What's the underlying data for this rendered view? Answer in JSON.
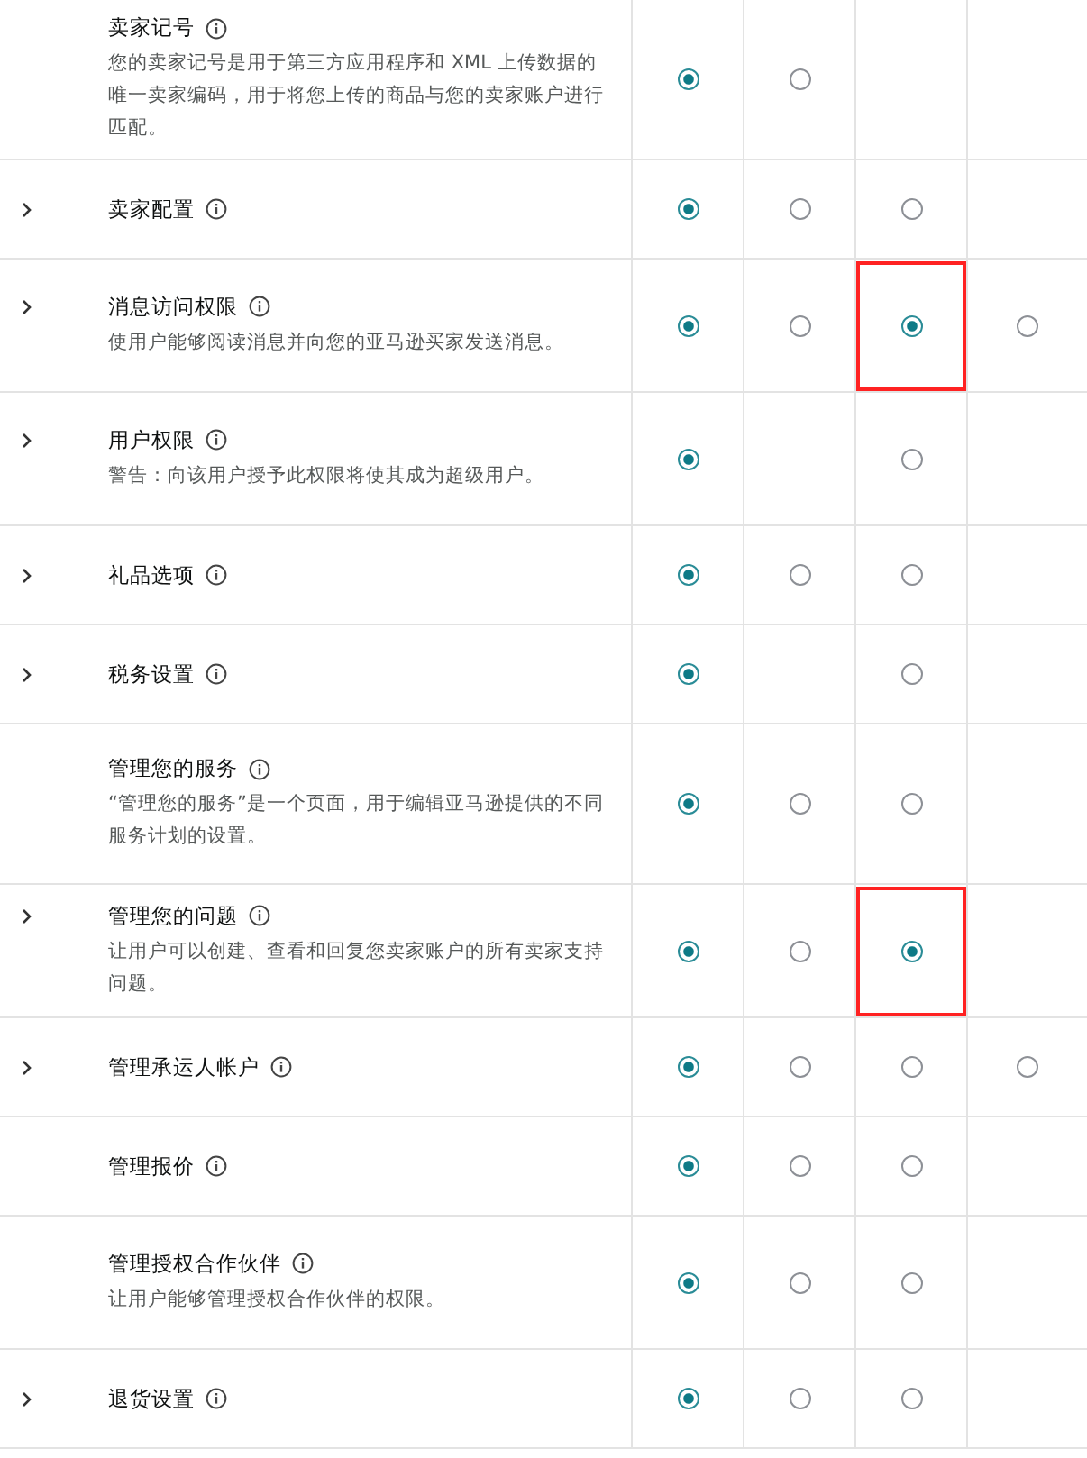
{
  "rows": [
    {
      "title": "卖家记号",
      "expandable": false,
      "description": "您的卖家记号是用于第三方应用程序和 XML 上传数据的唯一卖家编码，用于将您上传的商品与您的卖家账户进行匹配。",
      "options": [
        {
          "kind": "radio",
          "selected": true
        },
        {
          "kind": "radio",
          "selected": false
        },
        {
          "kind": "empty"
        },
        {
          "kind": "empty"
        }
      ]
    },
    {
      "title": "卖家配置",
      "expandable": true,
      "options": [
        {
          "kind": "radio",
          "selected": true
        },
        {
          "kind": "radio",
          "selected": false
        },
        {
          "kind": "radio",
          "selected": false
        },
        {
          "kind": "empty"
        }
      ]
    },
    {
      "title": "消息访问权限",
      "expandable": true,
      "description": "使用户能够阅读消息并向您的亚马逊买家发送消息。",
      "options": [
        {
          "kind": "radio",
          "selected": true
        },
        {
          "kind": "radio",
          "selected": false
        },
        {
          "kind": "radio",
          "selected": true,
          "highlighted": true
        },
        {
          "kind": "radio",
          "selected": false
        }
      ]
    },
    {
      "title": "用户权限",
      "expandable": true,
      "description": "警告：向该用户授予此权限将使其成为超级用户。",
      "options": [
        {
          "kind": "radio",
          "selected": true
        },
        {
          "kind": "empty"
        },
        {
          "kind": "radio",
          "selected": false
        },
        {
          "kind": "empty"
        }
      ]
    },
    {
      "title": "礼品选项",
      "expandable": true,
      "options": [
        {
          "kind": "radio",
          "selected": true
        },
        {
          "kind": "radio",
          "selected": false
        },
        {
          "kind": "radio",
          "selected": false
        },
        {
          "kind": "empty"
        }
      ]
    },
    {
      "title": "税务设置",
      "expandable": true,
      "options": [
        {
          "kind": "radio",
          "selected": true
        },
        {
          "kind": "empty"
        },
        {
          "kind": "radio",
          "selected": false
        },
        {
          "kind": "empty"
        }
      ]
    },
    {
      "title": "管理您的服务",
      "expandable": false,
      "description": "“管理您的服务”是一个页面，用于编辑亚马逊提供的不同服务计划的设置。",
      "options": [
        {
          "kind": "radio",
          "selected": true
        },
        {
          "kind": "radio",
          "selected": false
        },
        {
          "kind": "radio",
          "selected": false
        },
        {
          "kind": "empty"
        }
      ]
    },
    {
      "title": "管理您的问题",
      "expandable": true,
      "description": "让用户可以创建、查看和回复您卖家账户的所有卖家支持问题。",
      "options": [
        {
          "kind": "radio",
          "selected": true
        },
        {
          "kind": "radio",
          "selected": false
        },
        {
          "kind": "radio",
          "selected": true,
          "highlighted": true
        },
        {
          "kind": "empty"
        }
      ]
    },
    {
      "title": "管理承运人帐户",
      "expandable": true,
      "options": [
        {
          "kind": "radio",
          "selected": true
        },
        {
          "kind": "radio",
          "selected": false
        },
        {
          "kind": "radio",
          "selected": false
        },
        {
          "kind": "radio",
          "selected": false
        }
      ]
    },
    {
      "title": "管理报价",
      "expandable": false,
      "options": [
        {
          "kind": "radio",
          "selected": true
        },
        {
          "kind": "radio",
          "selected": false
        },
        {
          "kind": "radio",
          "selected": false
        },
        {
          "kind": "empty"
        }
      ]
    },
    {
      "title": "管理授权合作伙伴",
      "expandable": false,
      "description": "让用户能够管理授权合作伙伴的权限。",
      "options": [
        {
          "kind": "radio",
          "selected": true
        },
        {
          "kind": "radio",
          "selected": false
        },
        {
          "kind": "radio",
          "selected": false
        },
        {
          "kind": "empty"
        }
      ]
    },
    {
      "title": "退货设置",
      "expandable": true,
      "options": [
        {
          "kind": "radio",
          "selected": true
        },
        {
          "kind": "radio",
          "selected": false
        },
        {
          "kind": "radio",
          "selected": false
        },
        {
          "kind": "empty"
        }
      ]
    }
  ]
}
